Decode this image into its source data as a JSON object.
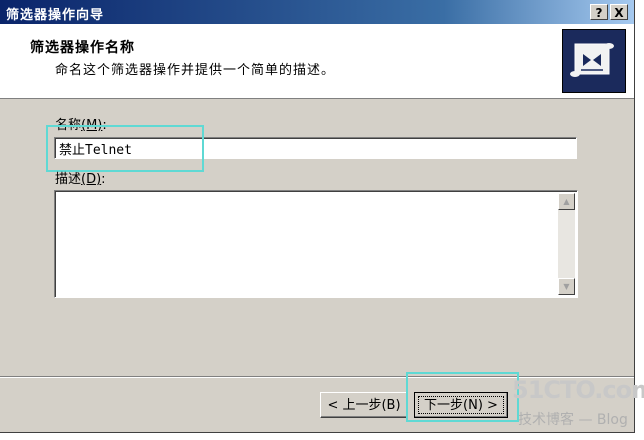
{
  "window": {
    "title": "筛选器操作向导"
  },
  "titlebar": {
    "help_label": "?",
    "close_label": "X"
  },
  "header": {
    "title": "筛选器操作名称",
    "subtitle": "命名这个筛选器操作并提供一个简单的描述。"
  },
  "form": {
    "name_label": "名称",
    "name_accel": "(M)",
    "name_suffix": ":",
    "name_value": "禁止Telnet",
    "desc_label": "描述",
    "desc_accel": "(D)",
    "desc_suffix": ":",
    "desc_value": ""
  },
  "buttons": {
    "back": "< 上一步(B)",
    "next": "下一步(N) >"
  },
  "watermark": {
    "line1": "51CTO.com",
    "line2": "技术博客 — Blog"
  },
  "colors": {
    "titlebar_start": "#0a246a",
    "face": "#d4d0c8",
    "highlight": "#5fd9d4"
  }
}
